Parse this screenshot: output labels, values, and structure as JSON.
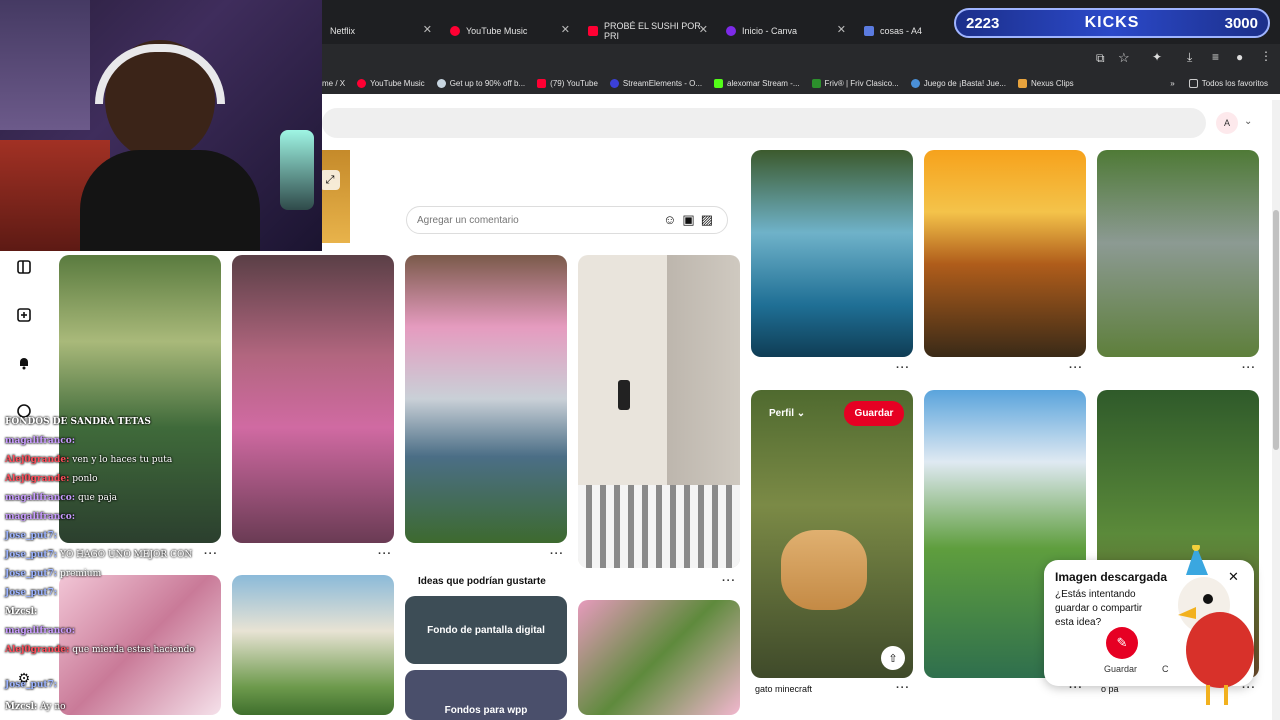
{
  "browser": {
    "tabs": [
      {
        "title": "Netflix",
        "color": "#e50914"
      },
      {
        "title": "YouTube Music",
        "color": "#ff0033"
      },
      {
        "title": "PROBÉ EL SUSHI POR PRI",
        "color": "#ff0033"
      },
      {
        "title": "Inicio - Canva",
        "color": "#7d2ae8"
      },
      {
        "title": "cosas - A4",
        "color": "#5b7be0"
      }
    ],
    "bookmarks": [
      {
        "label": "me / X",
        "color": "#000000"
      },
      {
        "label": "YouTube Music",
        "color": "#ff0033"
      },
      {
        "label": "Get up to 90% off b...",
        "color": "#171a21"
      },
      {
        "label": "(79) YouTube",
        "color": "#ff0033"
      },
      {
        "label": "StreamElements - O...",
        "color": "#3b40d8"
      },
      {
        "label": "alexomar Stream -...",
        "color": "#53fc18"
      },
      {
        "label": "Friv® | Friv Clasico...",
        "color": "#2c8f2c"
      },
      {
        "label": "Juego de ¡Basta! Jue...",
        "color": "#4a90d9"
      },
      {
        "label": "Nexus Clips",
        "color": "#e8a33d"
      }
    ],
    "bookmarks_more": "»",
    "all_favorites": "Todos los favoritos"
  },
  "kicks": {
    "left": "2223",
    "title": "KICKS",
    "right": "3000"
  },
  "search": {
    "avatar": "A"
  },
  "comment": {
    "placeholder": "Agregar un comentario"
  },
  "pins": {
    "hover_profile": "Perfil",
    "save": "Guardar",
    "cat_caption": "gato minecraft",
    "last_caption": "o pa",
    "ideas_title": "Ideas que podrían gustarte",
    "idea1": "Fondo de pantalla digital",
    "idea2": "Fondos para wpp"
  },
  "popup": {
    "title": "Imagen descargada",
    "text": "¿Estás intentando guardar o compartir esta idea?",
    "save_label": "Guardar",
    "second_label": "C"
  },
  "chat": [
    {
      "user": "FONDOS DE SANDRA TETAS",
      "msg": ""
    },
    {
      "user": "magalifranco:",
      "msg": ""
    },
    {
      "user": "Alej0grande:",
      "msg": "ven y lo haces tu puta"
    },
    {
      "user": "Alej0grande:",
      "msg": "ponlo"
    },
    {
      "user": "magalifranco:",
      "msg": "que paja"
    },
    {
      "user": "magalifranco:",
      "msg": ""
    },
    {
      "user": "Jose_put7:",
      "msg": ""
    },
    {
      "user": "Jose_put7:",
      "msg": "YO HAGO UNO MEJOR CON"
    },
    {
      "user": "Jose_put7:",
      "msg": "premium"
    },
    {
      "user": "Jose_put7:",
      "msg": ""
    },
    {
      "user": "Mzcsl:",
      "msg": ""
    },
    {
      "user": "magalifranco:",
      "msg": ""
    },
    {
      "user": "Alej0grande:",
      "msg": "que mierda estas haciendo"
    },
    {
      "user": "Jose_put7:",
      "msg": ""
    },
    {
      "user": "Mzcsl:",
      "msg": "Ay no"
    }
  ]
}
